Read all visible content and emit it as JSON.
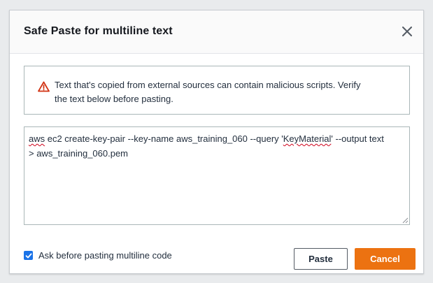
{
  "dialog": {
    "title": "Safe Paste for multiline text",
    "close_icon": "close-icon"
  },
  "alert": {
    "icon": "warning-triangle-icon",
    "icon_color": "#d13212",
    "message_line1": "Text that's copied from external sources can contain malicious scripts. Verify",
    "message_line2": "the text below before pasting."
  },
  "editor": {
    "word_aws": "aws",
    "text_part1": " ec2 create-key-pair --key-name aws_training_060 --query '",
    "word_keymaterial": "KeyMaterial",
    "text_part2": "' --output text",
    "line2": "> aws_training_060.pem"
  },
  "footer": {
    "checkbox_checked": true,
    "checkbox_label": "Ask before pasting multiline code",
    "paste_label": "Paste",
    "cancel_label": "Cancel"
  },
  "colors": {
    "accent": "#ec7211",
    "checkbox": "#1a73e8"
  }
}
